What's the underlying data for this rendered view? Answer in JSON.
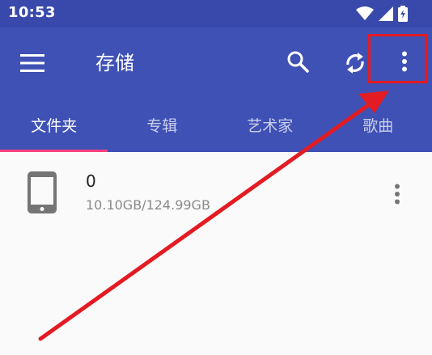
{
  "status_bar": {
    "time": "10:53"
  },
  "app_bar": {
    "title": "存储"
  },
  "tabs": [
    {
      "label": "文件夹",
      "active": true
    },
    {
      "label": "专辑",
      "active": false
    },
    {
      "label": "艺术家",
      "active": false
    },
    {
      "label": "歌曲",
      "active": false
    }
  ],
  "storage": [
    {
      "name": "0",
      "size": "10.10GB/124.99GB"
    }
  ],
  "colors": {
    "primary": "#3f51b5",
    "status_bar": "#3949ab",
    "accent": "#ff4081",
    "annotation": "#e31b23"
  },
  "icons": {
    "menu": "menu-icon",
    "search": "search-icon",
    "sync": "sync-icon",
    "more": "more-vert-icon",
    "device": "phone-icon"
  }
}
